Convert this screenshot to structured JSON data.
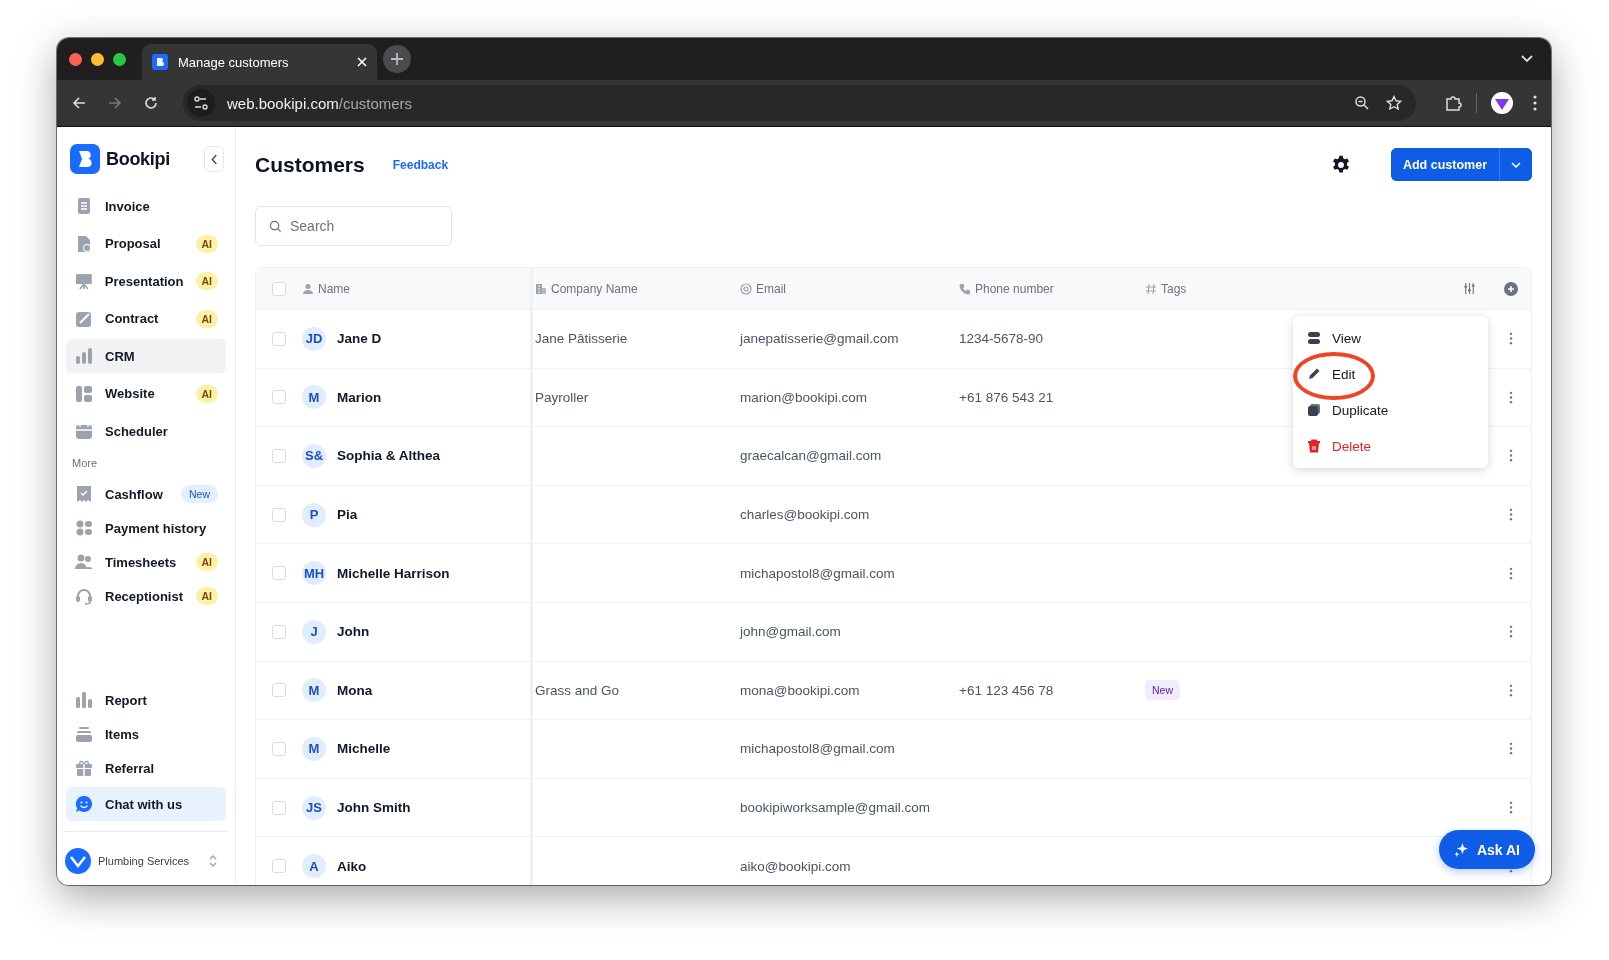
{
  "browser": {
    "tab_title": "Manage customers",
    "url_host": "web.bookipi.com",
    "url_path": "/customers"
  },
  "sidebar": {
    "brand": "Bookipi",
    "items": [
      {
        "label": "Invoice",
        "selected": false
      },
      {
        "label": "Proposal",
        "selected": false,
        "badge": {
          "text": "AI",
          "kind": "ai"
        }
      },
      {
        "label": "Presentation",
        "selected": false,
        "badge": {
          "text": "AI",
          "kind": "ai"
        }
      },
      {
        "label": "Contract",
        "selected": false,
        "badge": {
          "text": "AI",
          "kind": "ai"
        }
      },
      {
        "label": "CRM",
        "selected": true
      },
      {
        "label": "Website",
        "selected": false,
        "badge": {
          "text": "AI",
          "kind": "ai"
        }
      },
      {
        "label": "Scheduler",
        "selected": false
      }
    ],
    "section_label": "More",
    "more_items": [
      {
        "label": "Cashflow",
        "selected": false,
        "badge": {
          "text": "New",
          "kind": "new"
        }
      },
      {
        "label": "Payment history",
        "selected": false
      },
      {
        "label": "Timesheets",
        "selected": false,
        "badge": {
          "text": "AI",
          "kind": "ai"
        }
      },
      {
        "label": "Receptionist",
        "selected": false,
        "badge": {
          "text": "AI",
          "kind": "ai"
        }
      }
    ],
    "bottom_items": [
      {
        "label": "Report",
        "selected": false
      },
      {
        "label": "Items",
        "selected": false
      },
      {
        "label": "Referral",
        "selected": false
      }
    ],
    "chat_button": {
      "label": "Chat with us"
    },
    "workspace": {
      "name": "Plumbing Services"
    }
  },
  "header": {
    "title": "Customers",
    "feedback_link": "Feedback",
    "add_button": "Add customer"
  },
  "search": {
    "placeholder": "Search"
  },
  "table": {
    "select_all": {
      "checked": false
    },
    "columns": [
      {
        "label": "Name"
      },
      {
        "label": "Company Name"
      },
      {
        "label": "Email"
      },
      {
        "label": "Phone number"
      },
      {
        "label": "Tags"
      }
    ],
    "rows": [
      {
        "checked": false,
        "initials": "JD",
        "name": "Jane D",
        "company": "Jane Pâtisserie",
        "email": "janepatisserie@gmail.com",
        "phone": "1234-5678-90"
      },
      {
        "checked": false,
        "initials": "M",
        "name": "Marion",
        "company": "Payroller",
        "email": "marion@bookipi.com",
        "phone": "+61 876 543 21"
      },
      {
        "checked": false,
        "initials": "S&",
        "name": "Sophia & Althea",
        "email": "graecalcan@gmail.com"
      },
      {
        "checked": false,
        "initials": "P",
        "name": "Pia",
        "email": "charles@bookipi.com"
      },
      {
        "checked": false,
        "initials": "MH",
        "name": "Michelle Harrison",
        "email": "michapostol8@gmail.com"
      },
      {
        "checked": false,
        "initials": "J",
        "name": "John",
        "email": "john@gmail.com"
      },
      {
        "checked": false,
        "initials": "M",
        "name": "Mona",
        "company": "Grass and Go",
        "email": "mona@bookipi.com",
        "phone": "+61 123 456 78",
        "tags": [
          "New"
        ]
      },
      {
        "checked": false,
        "initials": "M",
        "name": "Michelle",
        "email": "michapostol8@gmail.com"
      },
      {
        "checked": false,
        "initials": "JS",
        "name": "John Smith",
        "email": "bookipiworksample@gmail.com"
      },
      {
        "checked": false,
        "initials": "A",
        "name": "Aiko",
        "email": "aiko@bookipi.com"
      }
    ],
    "row_menu": {
      "items": [
        {
          "label": "View",
          "kind": "view",
          "circled": false
        },
        {
          "label": "Edit",
          "kind": "edit",
          "circled": true
        },
        {
          "label": "Duplicate",
          "kind": "duplicate",
          "circled": false
        },
        {
          "label": "Delete",
          "kind": "delete",
          "circled": false
        }
      ]
    }
  },
  "ask_ai": {
    "label": "Ask AI"
  }
}
